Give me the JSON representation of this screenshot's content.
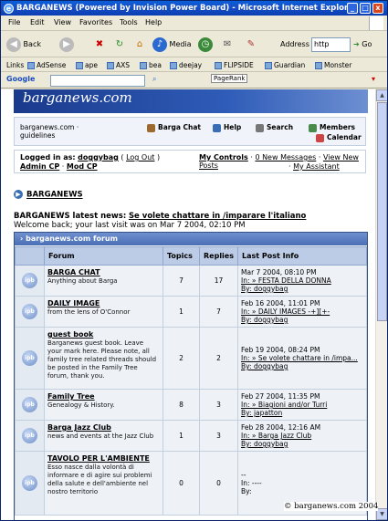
{
  "window": {
    "title": "BARGANEWS (Powered by Invision Power Board) - Microsoft Internet Explorer",
    "min": "_",
    "max": "□",
    "close": "x"
  },
  "menubar": [
    "File",
    "Edit",
    "View",
    "Favorites",
    "Tools",
    "Help"
  ],
  "toolbar": {
    "back": "Back",
    "media": "Media",
    "address_label": "Address",
    "address_value": "http",
    "go": "Go"
  },
  "links_bar": {
    "label": "Links",
    "items": [
      "AdSense",
      "ape",
      "AXS",
      "bea",
      "deejay",
      "FLIPSIDE",
      "Guardian",
      "Monster"
    ]
  },
  "google_bar": {
    "label": "Google",
    "pagerank": "PageRank"
  },
  "site": {
    "banner": "barganews.com",
    "guidelines_title": "barganews.com · guidelines",
    "nav": {
      "chat": "Barga Chat",
      "help": "Help",
      "search": "Search",
      "members": "Members",
      "calendar": "Calendar"
    },
    "login": {
      "logged_in_as": "Logged in as:",
      "user": "doggybag",
      "logout": "Log Out",
      "admin_cp": "Admin CP",
      "mod_cp": "Mod CP",
      "my_controls": "My Controls",
      "new_messages": "0 New Messages",
      "view_new_posts": "View New Posts",
      "my_assistant": "My Assistant"
    },
    "breadcrumb": "BARGANEWS",
    "latest_news_label": "BARGANEWS latest news:",
    "latest_news_link": "Se volete chattare in /imparare l'italiano",
    "welcome": "Welcome back; your last visit was on Mar 7 2004, 02:10 PM"
  },
  "forum_table": {
    "title": "barganews.com forum",
    "columns": [
      "Forum",
      "Topics",
      "Replies",
      "Last Post Info"
    ],
    "icon_label": "ipb",
    "rows": [
      {
        "name": "BARGA CHAT",
        "desc": "Anything about Barga",
        "topics": "7",
        "replies": "17",
        "lp_date": "Mar 7 2004, 08:10 PM",
        "lp_in": "In: » FESTA DELLA DONNA",
        "lp_by": "By: doggybag"
      },
      {
        "name": "DAILY IMAGE",
        "desc": "from the lens of O'Connor",
        "topics": "1",
        "replies": "7",
        "lp_date": "Feb 16 2004, 11:01 PM",
        "lp_in": "In: » DAILY IMAGES -+][+-",
        "lp_by": "By: doggybag"
      },
      {
        "name": "guest book",
        "desc": "Barganews guest book. Leave your mark here. Please note, all family tree related threads should be posted in the Family Tree forum, thank you.",
        "topics": "2",
        "replies": "2",
        "lp_date": "Feb 19 2004, 08:24 PM",
        "lp_in": "In: » Se volete chattare in /impa...",
        "lp_by": "By: doggybag"
      },
      {
        "name": "Family Tree",
        "desc": "Genealogy & History.",
        "topics": "8",
        "replies": "3",
        "lp_date": "Feb 27 2004, 11:35 PM",
        "lp_in": "In: » Biagioni and/or Turri",
        "lp_by": "By: japatton"
      },
      {
        "name": "Barga Jazz Club",
        "desc": "news and events at the Jazz Club",
        "topics": "1",
        "replies": "3",
        "lp_date": "Feb 28 2004, 12:16 AM",
        "lp_in": "In: » Barga Jazz Club",
        "lp_by": "By: doggybag"
      },
      {
        "name": "TAVOLO PER L'AMBIENTE",
        "desc": "Esso nasce dalla volontà di informare e di agire sui problemi della salute e dell'ambiente nel nostro territorio",
        "topics": "0",
        "replies": "0",
        "lp_date": "--",
        "lp_in": "In: ----",
        "lp_by": "By:"
      }
    ]
  },
  "copyright": "© barganews.com 2004",
  "colors": {
    "title_bar": "#0b3fb3",
    "forum_header": "#4a6fb5",
    "table_header": "#bccce6"
  }
}
